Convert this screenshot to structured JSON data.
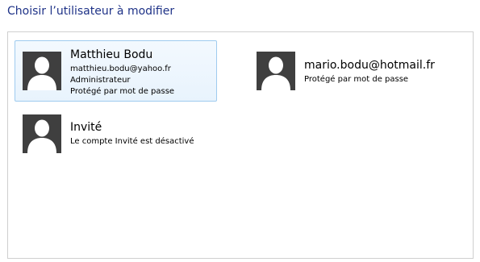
{
  "title": "Choisir l’utilisateur à modifier",
  "accounts": [
    {
      "name": "Matthieu Bodu",
      "email": "matthieu.bodu@yahoo.fr",
      "role": "Administrateur",
      "status": "Protégé par mot de passe",
      "avatar_icon": "user-silhouette-icon"
    },
    {
      "name": "mario.bodu@hotmail.fr",
      "status": "Protégé par mot de passe",
      "avatar_icon": "user-silhouette-icon"
    },
    {
      "name": "Invité",
      "status": "Le compte Invité est désactivé",
      "avatar_icon": "user-silhouette-icon"
    }
  ],
  "colors": {
    "title": "#1e3287",
    "avatar_bg": "#3f3f3f",
    "selected_border": "#9fcbef"
  }
}
